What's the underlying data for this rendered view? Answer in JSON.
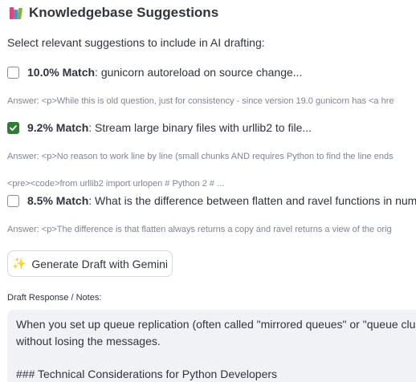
{
  "header": {
    "icon": "books-icon",
    "title": "Knowledgebase Suggestions"
  },
  "intro_text": "Select relevant suggestions to include in AI drafting:",
  "answer_label": "Answer",
  "suggestions": [
    {
      "checked": false,
      "match": "10.0% Match",
      "question": ": gunicorn autoreload on source change...",
      "answer": ": <p>While this is old question, just for consistency - since version 19.0 gunicorn has <a hre"
    },
    {
      "checked": true,
      "match": "9.2% Match",
      "question": ": Stream large binary files with urllib2 to file...",
      "answer": ": <p>No reason to work line by line (small chunks AND requires Python to find the line ends",
      "code_preview": "<pre><code>from urllib2 import urlopen # Python 2 # ..."
    },
    {
      "checked": false,
      "match": "8.5% Match",
      "question": ": What is the difference between flatten and ravel functions in numpy?",
      "answer": ": <p>The difference is that flatten always returns a copy and ravel returns a view of the orig"
    }
  ],
  "generate_button": {
    "icon": "sparkles-icon",
    "label": "Generate Draft with Gemini"
  },
  "draft": {
    "label": "Draft Response / Notes:",
    "lines": [
      "When you set up queue replication (often called \"mirrored queues\" or \"queue cluste",
      "without losing the messages.",
      "",
      "### Technical Considerations for Python Developers"
    ]
  },
  "colors": {
    "checkbox_checked": "#2e7d32",
    "draft_background": "#f0f2f6",
    "muted_text": "#808495",
    "text": "#31333f"
  }
}
